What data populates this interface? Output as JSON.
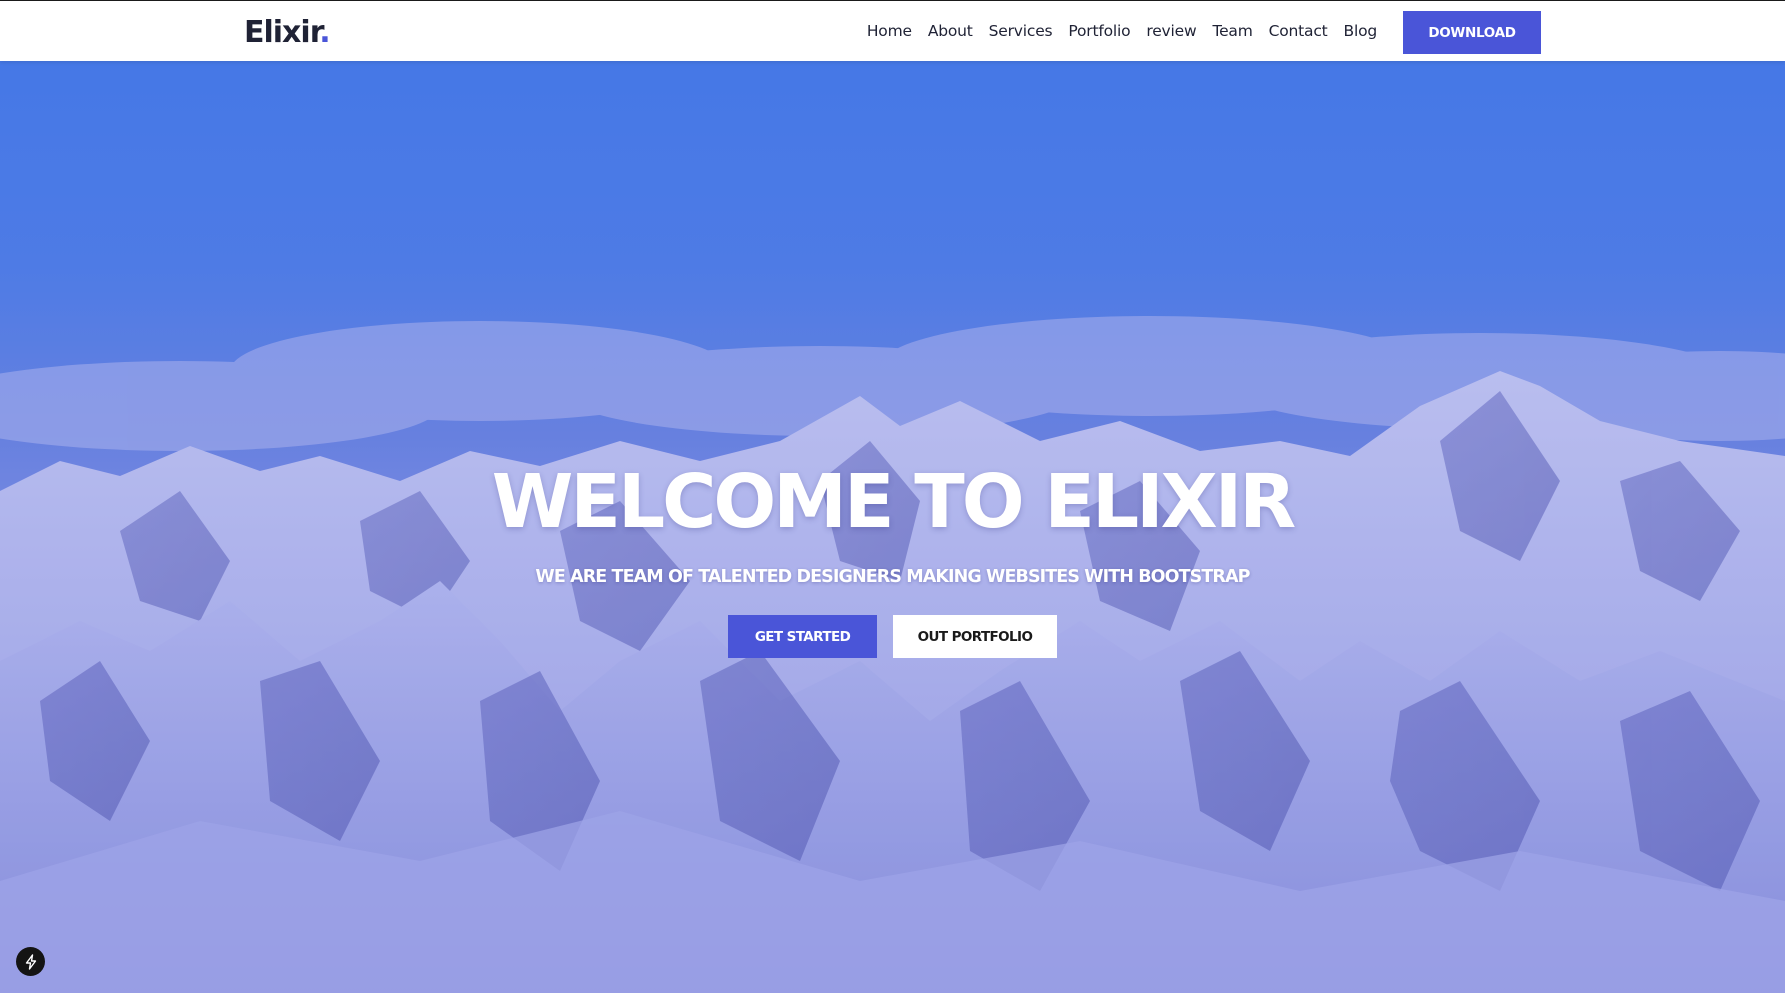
{
  "header": {
    "logo_text": "Elixir",
    "logo_dot": ".",
    "nav": [
      "Home",
      "About",
      "Services",
      "Portfolio",
      "review",
      "Team",
      "Contact",
      "Blog"
    ],
    "download_label": "DOWNLOAD"
  },
  "hero": {
    "title": "WELCOME TO ELIXIR",
    "subtitle": "WE ARE TEAM OF TALENTED DESIGNERS MAKING WEBSITES WITH BOOTSTRAP",
    "primary_button": "GET STARTED",
    "secondary_button": "OUT PORTFOLIO"
  },
  "icons": {
    "corner_badge": "lightning-bolt-icon"
  },
  "colors": {
    "accent": "#4a55d8",
    "nav_text": "#1f2235",
    "hero_sky": "#457de8"
  }
}
